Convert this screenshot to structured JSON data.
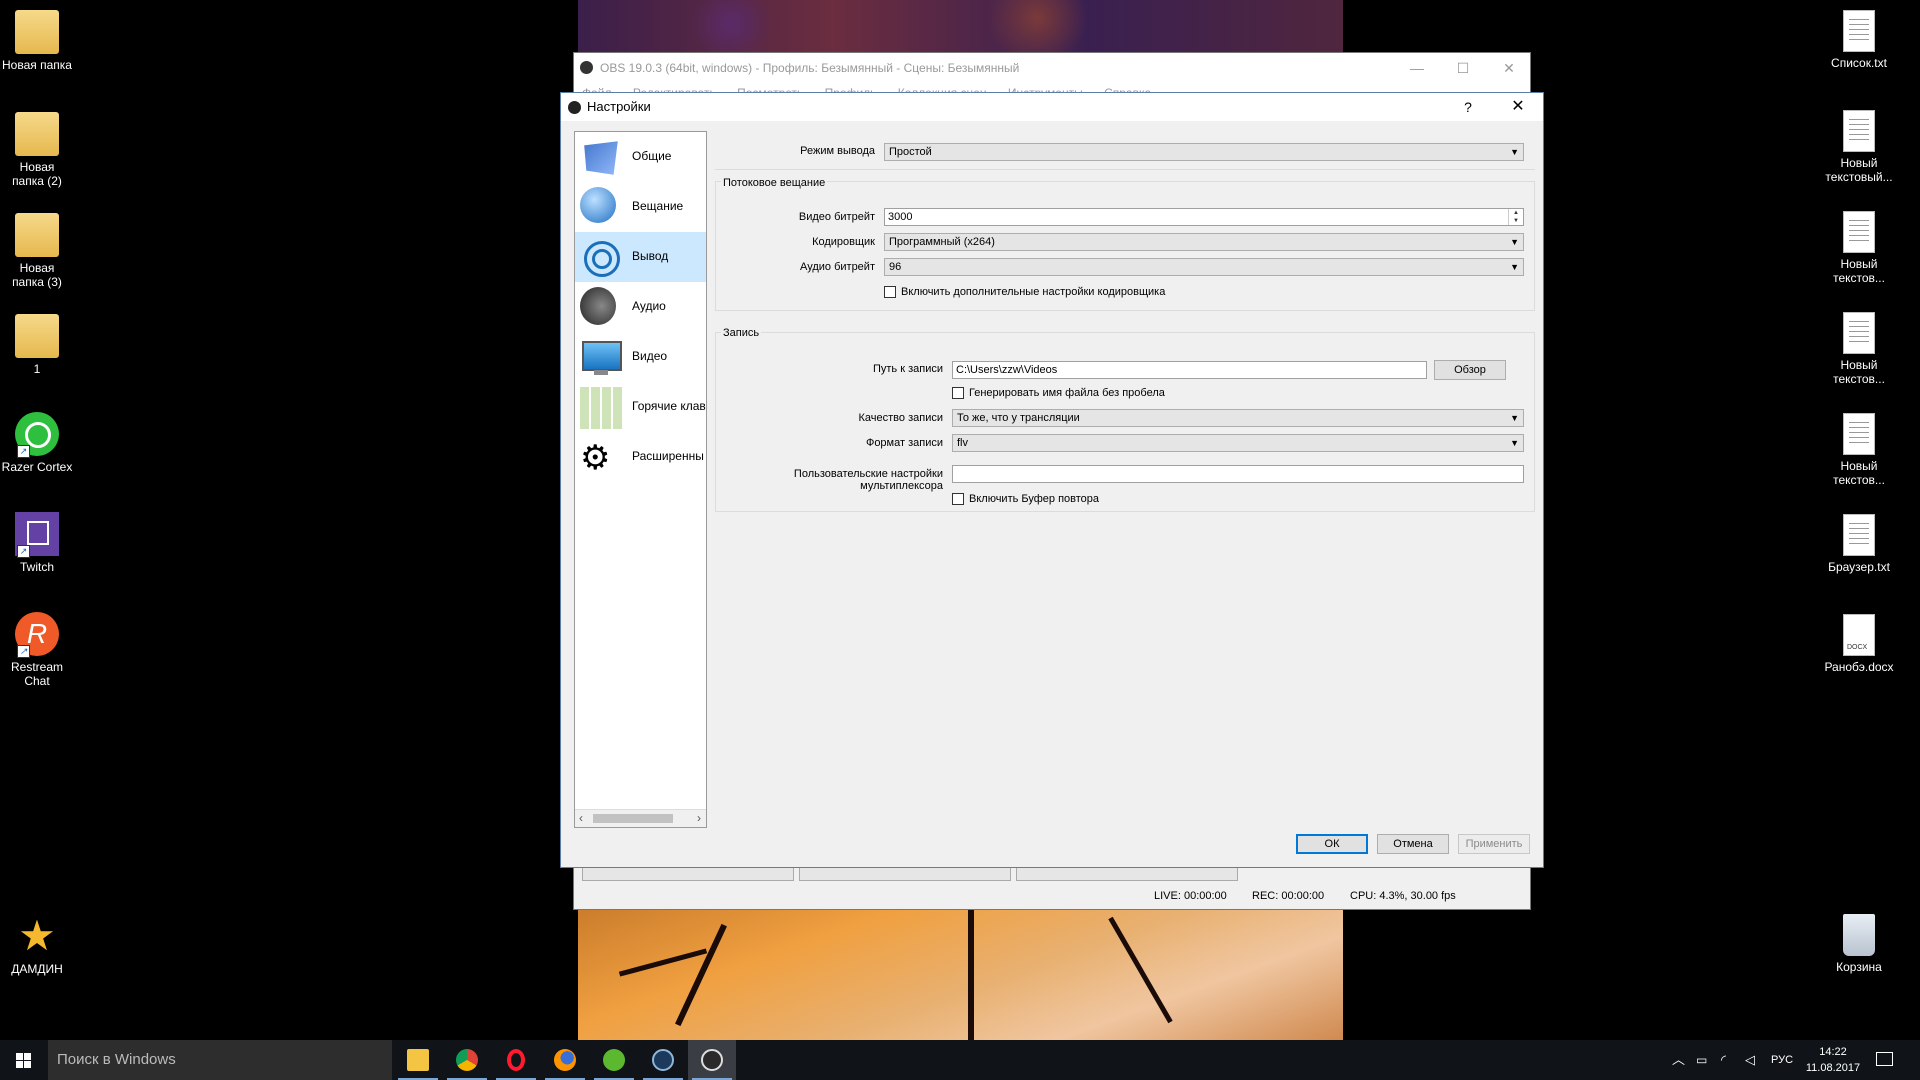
{
  "desktop": {
    "left_icons": [
      {
        "label": "Новая папка",
        "icon": "folder-icon"
      },
      {
        "label": "Новая папка (2)",
        "icon": "folder-icon"
      },
      {
        "label": "Новая папка (3)",
        "icon": "folder-icon"
      },
      {
        "label": "1",
        "icon": "folder-icon"
      },
      {
        "label": "Razer Cortex",
        "icon": "razer-cortex-icon"
      },
      {
        "label": "Twitch",
        "icon": "twitch-icon"
      },
      {
        "label": "Restream Chat",
        "icon": "restream-icon"
      },
      {
        "label": "ДАМДИН",
        "icon": "star-icon"
      }
    ],
    "right_icons": [
      {
        "label": "Список.txt",
        "icon": "text-file-icon"
      },
      {
        "label": "Новый текстовый...",
        "icon": "text-file-icon"
      },
      {
        "label": "Новый текстов...",
        "icon": "text-file-icon"
      },
      {
        "label": "Новый текстов...",
        "icon": "text-file-icon"
      },
      {
        "label": "Новый текстов...",
        "icon": "text-file-icon"
      },
      {
        "label": "Браузер.txt",
        "icon": "text-file-icon"
      },
      {
        "label": "Ранобэ.docx",
        "icon": "docx-file-icon"
      },
      {
        "label": "Корзина",
        "icon": "recycle-bin-icon"
      }
    ],
    "docx_badge": "DOCX"
  },
  "obs_main": {
    "title": "OBS 19.0.3 (64bit, windows) - Профиль: Безымянный - Сцены: Безымянный",
    "menu": [
      "Файл",
      "Редактировать",
      "Посмотреть",
      "Профиль",
      "Коллекция сцен",
      "Инструменты",
      "Справка"
    ],
    "status": {
      "live": "LIVE: 00:00:00",
      "rec": "REC: 00:00:00",
      "cpu": "CPU: 4.3%, 30.00 fps"
    },
    "window_controls": {
      "minimize": "—",
      "maximize": "☐",
      "close": "✕"
    }
  },
  "settings": {
    "title": "Настройки",
    "help": "?",
    "close": "✕",
    "sidebar": [
      {
        "label": "Общие",
        "icon": "general-icon",
        "active": false
      },
      {
        "label": "Вещание",
        "icon": "stream-icon",
        "active": false
      },
      {
        "label": "Вывод",
        "icon": "output-icon",
        "active": true
      },
      {
        "label": "Аудио",
        "icon": "audio-icon",
        "active": false
      },
      {
        "label": "Видео",
        "icon": "video-icon",
        "active": false
      },
      {
        "label": "Горячие клав",
        "icon": "hotkeys-icon",
        "active": false
      },
      {
        "label": "Расширенны",
        "icon": "advanced-icon",
        "active": false
      }
    ],
    "output_mode": {
      "label": "Режим вывода",
      "value": "Простой"
    },
    "streaming": {
      "title": "Потоковое вещание",
      "video_bitrate": {
        "label": "Видео битрейт",
        "value": "3000"
      },
      "encoder": {
        "label": "Кодировщик",
        "value": "Программный (x264)"
      },
      "audio_bitrate": {
        "label": "Аудио битрейт",
        "value": "96"
      },
      "advanced_encoder": {
        "label": "Включить дополнительные настройки кодировщика",
        "checked": false
      }
    },
    "recording": {
      "title": "Запись",
      "path": {
        "label": "Путь к записи",
        "value": "C:\\Users\\zzw\\Videos",
        "browse": "Обзор"
      },
      "no_space": {
        "label": "Генерировать имя файла без пробела",
        "checked": false
      },
      "quality": {
        "label": "Качество записи",
        "value": "То же, что у трансляции"
      },
      "format": {
        "label": "Формат записи",
        "value": "flv"
      },
      "muxer": {
        "label": "Пользовательские настройки мультиплексора",
        "value": ""
      },
      "replay_buffer": {
        "label": "Включить Буфер повтора",
        "checked": false
      }
    },
    "buttons": {
      "ok": "ОК",
      "cancel": "Отмена",
      "apply": "Применить"
    }
  },
  "taskbar": {
    "search_placeholder": "Поиск в Windows",
    "apps": [
      "file-explorer-icon",
      "chrome-icon",
      "opera-icon",
      "firefox-icon",
      "utorrent-icon",
      "steam-icon",
      "obs-icon"
    ],
    "language": "РУС",
    "time": "14:22",
    "date": "11.08.2017"
  }
}
